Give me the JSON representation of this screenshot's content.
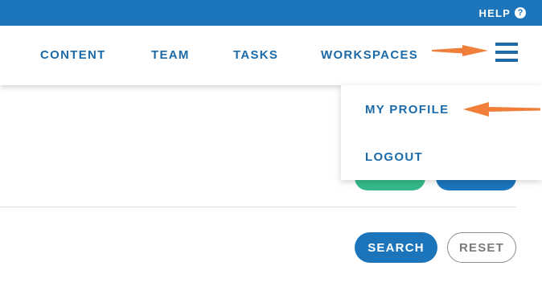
{
  "topbar": {
    "help_label": "HELP",
    "help_icon": "?"
  },
  "nav": {
    "links": [
      "CONTENT",
      "TEAM",
      "TASKS",
      "WORKSPACES"
    ],
    "menu_icon": "hamburger-menu-icon"
  },
  "dropdown": {
    "items": [
      "MY PROFILE",
      "LOGOUT"
    ]
  },
  "actions": {
    "search_label": "SEARCH",
    "reset_label": "RESET"
  },
  "colors": {
    "brand_blue": "#1c75ba",
    "link_blue": "#1c6aa8",
    "green": "#35b98a",
    "annotation_orange": "#f07f3c"
  }
}
